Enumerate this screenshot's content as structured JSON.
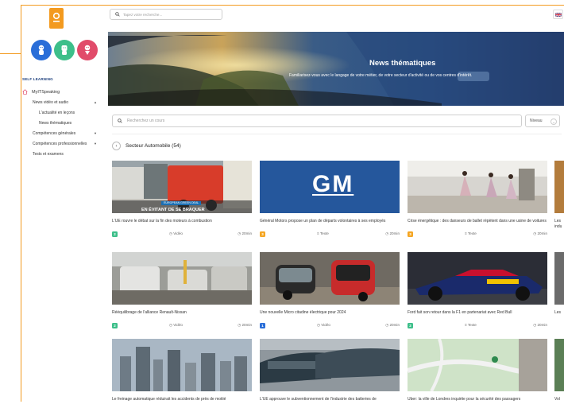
{
  "search": {
    "placeholder": "Tapez votre recherche..."
  },
  "sidebar": {
    "section_title": "SELF LEARNING",
    "items": [
      {
        "label": "MyITSpeaking",
        "level": "top"
      },
      {
        "label": "News vidéo et audio",
        "level": "l1",
        "caret": "▲"
      },
      {
        "label": "L'actualité en leçons",
        "level": "l2"
      },
      {
        "label": "News thématiques",
        "level": "l2"
      },
      {
        "label": "Compétences générales",
        "level": "l1",
        "caret": "▼"
      },
      {
        "label": "Compétences professionnelles",
        "level": "l1",
        "caret": "▼"
      },
      {
        "label": "Tests et examens",
        "level": "l1"
      }
    ]
  },
  "banner": {
    "title": "News thématiques",
    "subtitle": "Familiarisez-vous avec le langage de votre métier, de votre secteur d'activité ou de vos centres d'intérêt."
  },
  "course_search": {
    "placeholder": "Recherchez un cours"
  },
  "level_filter": {
    "label": "Niveau"
  },
  "sector": {
    "title": "Secteur Automobile (54)"
  },
  "cards": [
    {
      "title": "L'UE rouvre le débat sur la fin des moteurs à combustion",
      "level": "2",
      "badge_color": "#3dbf8a",
      "type": "Vidéo",
      "duration": "20min",
      "overlay_tag": "EUROPEAN GREEN DEAL",
      "overlay_caption": "EN ÉVITANT DE SE BRAQUER"
    },
    {
      "title": "Général Motors propose un plan de départs volontaires à ses employés",
      "level": "3",
      "badge_color": "#f5a623",
      "type": "Texte",
      "duration": "20min",
      "logo_text": "GM"
    },
    {
      "title": "Crise énergétique : des danseurs de ballet répètent dans une usine de voitures",
      "level": "3",
      "badge_color": "#f5a623",
      "type": "Texte",
      "duration": "20min"
    },
    {
      "title": "Rééquilibrage de l'alliance Renault-Nissan",
      "level": "2",
      "badge_color": "#3dbf8a",
      "type": "Vidéo",
      "duration": "20min"
    },
    {
      "title": "Une nouvelle Micro citadine électrique pour 2024",
      "level": "1",
      "badge_color": "#2a6ed8",
      "type": "Vidéo",
      "duration": "20min"
    },
    {
      "title": "Ford fait son retour dans la F1 en partenariat avec Red Bull",
      "level": "2",
      "badge_color": "#3dbf8a",
      "type": "Texte",
      "duration": "20min"
    },
    {
      "title": "Le freinage automatique réduirait les accidents de près de moitié",
      "level": "",
      "badge_color": "#3dbf8a",
      "type": "",
      "duration": ""
    },
    {
      "title": "L'UE approuve le subventionnement de l'industrie des batteries de",
      "level": "",
      "badge_color": "#2a6ed8",
      "type": "",
      "duration": ""
    },
    {
      "title": "Uber: la ville de Londres inquiète pour la sécurité des passagers",
      "level": "",
      "badge_color": "#f5a623",
      "type": "",
      "duration": ""
    }
  ],
  "edge_cards": [
    {
      "title": "Les indu",
      "badge_color": "#f5a623"
    },
    {
      "title": "Les",
      "badge_color": "#f5a623"
    },
    {
      "title": "Vol",
      "badge_color": "#f5a623"
    }
  ],
  "colors": {
    "accent": "#f39a1f",
    "nav_title": "#1a3d7c",
    "green": "#3dbf8a",
    "blue": "#2a6ed8",
    "orange": "#f5a623"
  },
  "icons": {
    "logo": "itspeaking-logo-icon",
    "home": "home-icon",
    "search": "search-icon",
    "flag": "uk-flag-icon",
    "back": "chevron-left-icon",
    "video": "clock-icon",
    "text": "text-icon",
    "duration": "clock-icon"
  }
}
